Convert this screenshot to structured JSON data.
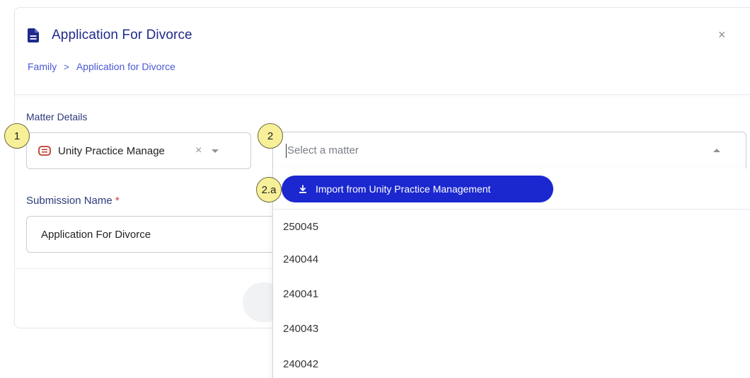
{
  "dialog": {
    "title": "Application For Divorce",
    "close_icon": "close-icon"
  },
  "breadcrumb": {
    "items": [
      "Family",
      "Application for Divorce"
    ],
    "separator": ">"
  },
  "matter_details": {
    "label": "Matter Details",
    "source": {
      "value": "Unity Practice Manage",
      "clear_symbol": "×"
    },
    "matter_select": {
      "placeholder": "Select a matter"
    }
  },
  "submission": {
    "label": "Submission Name",
    "required_mark": "*",
    "value": "Application For Divorce"
  },
  "dropdown": {
    "import_label": "Import from Unity Practice Management",
    "options": [
      "250045",
      "240044",
      "240041",
      "240043",
      "240042"
    ]
  },
  "badges": [
    "1",
    "2",
    "2.a"
  ],
  "colors": {
    "title": "#1f2a8a",
    "link": "#4a58d6",
    "primary_button": "#1b27cf",
    "required": "#d33a3a",
    "badge_fill": "#f7f099"
  }
}
